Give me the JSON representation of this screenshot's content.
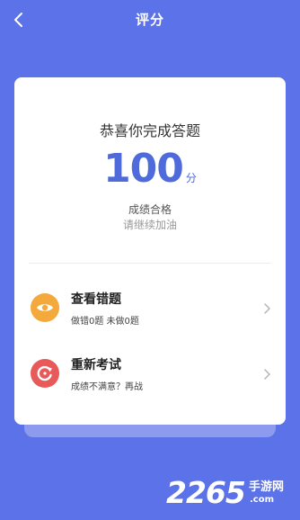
{
  "header": {
    "title": "评分",
    "back_icon": "chevron-left-icon"
  },
  "result": {
    "congrats": "恭喜你完成答题",
    "score": "100",
    "score_unit": "分",
    "status": "成绩合格",
    "encouragement": "请继续加油"
  },
  "actions": [
    {
      "title": "查看错题",
      "subtitle": "做错0题 未做0题",
      "icon": "eye-icon",
      "icon_color": "#f3a93b"
    },
    {
      "title": "重新考试",
      "subtitle": "成绩不满意？再战",
      "icon": "refresh-icon",
      "icon_color": "#e85a5a"
    }
  ],
  "colors": {
    "background": "#5b72e8",
    "accent": "#4f6bdb"
  },
  "watermark": {
    "brand": "2265",
    "brand_cn": "手游网",
    "url": ".com"
  }
}
